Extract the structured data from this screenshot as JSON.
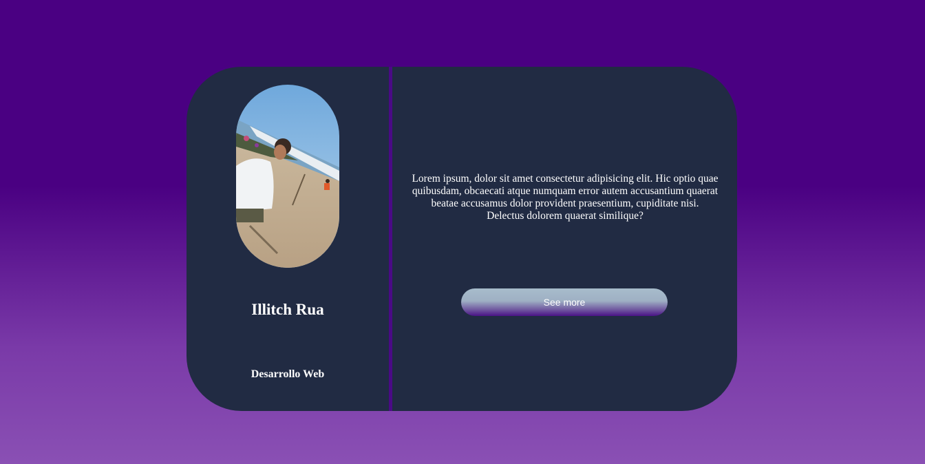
{
  "profile": {
    "name": "Illitch Rua",
    "role": "Desarrollo Web",
    "photo_icon": "profile-photo"
  },
  "content": {
    "description": "Lorem ipsum, dolor sit amet consectetur adipisicing elit. Hic optio quae quibusdam, obcaecati atque numquam error autem accusantium quaerat beatae accusamus dolor provident praesentium, cupiditate nisi. Delectus dolorem quaerat similique?",
    "button_label": "See more"
  },
  "colors": {
    "page_top": "#4a0082",
    "page_bottom": "#8a50b4",
    "card": "#212b43",
    "divider": "#4a0a86",
    "text": "#ffffff"
  }
}
